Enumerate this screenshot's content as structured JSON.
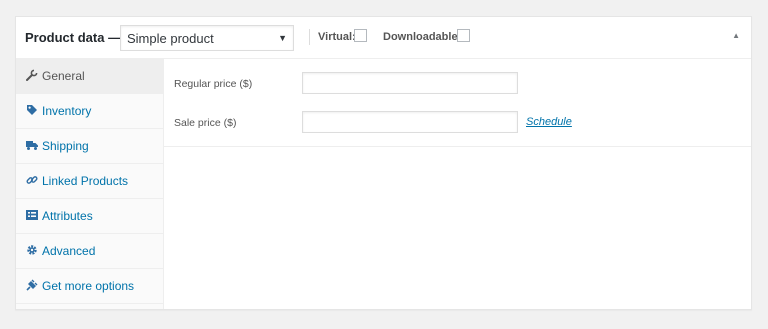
{
  "header": {
    "title": "Product data —",
    "product_type": "Simple product",
    "virtual_label": "Virtual:",
    "downloadable_label": "Downloadable:"
  },
  "tabs": [
    {
      "label": "General",
      "icon": "wrench-icon",
      "active": true
    },
    {
      "label": "Inventory",
      "icon": "tag-icon",
      "active": false
    },
    {
      "label": "Shipping",
      "icon": "truck-icon",
      "active": false
    },
    {
      "label": "Linked Products",
      "icon": "link-icon",
      "active": false
    },
    {
      "label": "Attributes",
      "icon": "list-icon",
      "active": false
    },
    {
      "label": "Advanced",
      "icon": "gear-icon",
      "active": false
    },
    {
      "label": "Get more options",
      "icon": "plug-icon",
      "active": false
    }
  ],
  "general": {
    "regular_price_label": "Regular price ($)",
    "regular_price_value": "",
    "sale_price_label": "Sale price ($)",
    "sale_price_value": "",
    "schedule_label": "Schedule"
  },
  "colors": {
    "link": "#0073aa",
    "icon": "#2e6da4",
    "active_tab_bg": "#eeeeee",
    "sidebar_bg": "#fafafa"
  }
}
